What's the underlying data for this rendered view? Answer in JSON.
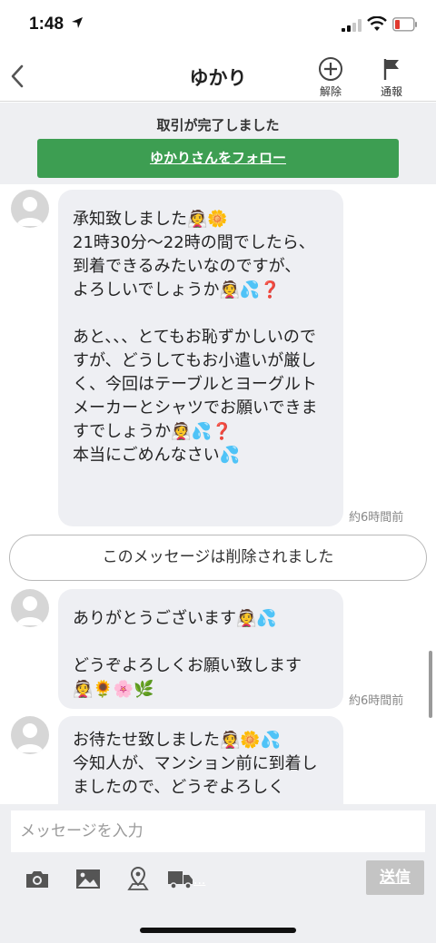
{
  "status": {
    "time": "1:48"
  },
  "nav": {
    "title": "ゆかり",
    "unblock_label": "解除",
    "report_label": "通報"
  },
  "banner": {
    "text": "取引が完了しました",
    "follow_label": "ゆかりさんをフォロー"
  },
  "messages": [
    {
      "para1": "承知致しました👰🌼\n21時30分〜22時の間でしたら、\n到着できるみたいなのですが、\nよろしいでしょうか👰💦❓",
      "para2": "あと、、、とてもお恥ずかしいのですが、どうしてもお小遣いが厳しく、今回はテーブルとヨーグルトメーカーとシャツでお願いできますでしょうか👰💦❓\n本当にごめんなさい💦",
      "time": "約6時間前"
    },
    {
      "deleted_text": "このメッセージは削除されました"
    },
    {
      "para1": "ありがとうございます👰💦",
      "para2": "どうぞよろしくお願い致します\n👰🌻🌸🌿",
      "time": "約6時間前"
    },
    {
      "para1": "お待たせ致しました👰🌼💦\n今知人が、マンション前に到着しましたので、どうぞよろしく"
    }
  ],
  "composer": {
    "placeholder": "メッセージを入力",
    "send_label": "送信",
    "ship_ellipsis": "..."
  },
  "colors": {
    "follow_green": "#3d9e52",
    "bubble": "#eeeff3",
    "send_disabled": "#c4c4c4"
  }
}
